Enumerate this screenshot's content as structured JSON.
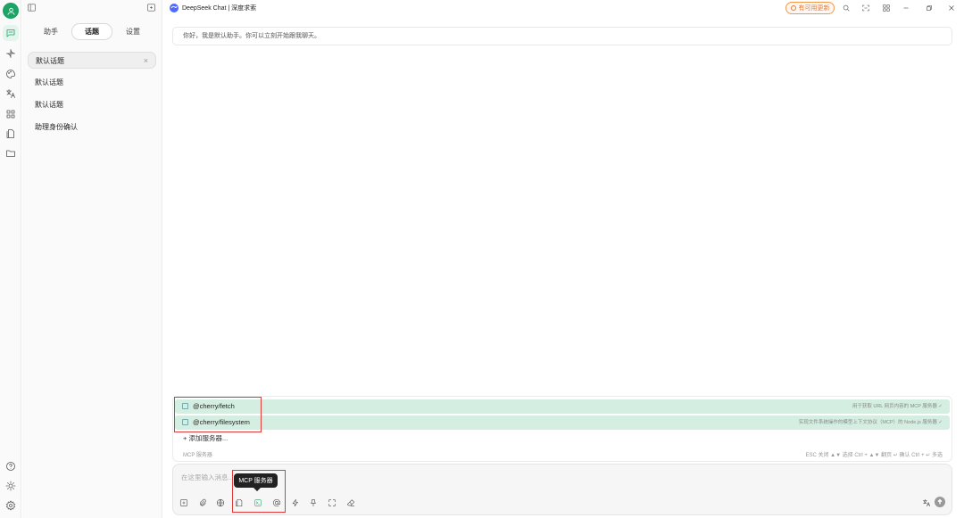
{
  "app": {
    "model_name": "DeepSeek Chat | 深度求索",
    "update_label": "有可用更新"
  },
  "colors": {
    "accent": "#1ba466",
    "update": "#e8793a",
    "highlight_row": "#d4efe2",
    "annotation_box": "#e03a3a"
  },
  "rail": {
    "icons": [
      "user-avatar",
      "chat-icon",
      "sparkle-icon",
      "palette-icon",
      "translate-icon",
      "apps-icon",
      "files-icon",
      "folder-icon"
    ],
    "bottom_icons": [
      "help-icon",
      "theme-icon",
      "settings-icon"
    ]
  },
  "panel": {
    "tabs": [
      {
        "label": "助手"
      },
      {
        "label": "话题",
        "active": true
      },
      {
        "label": "设置"
      }
    ],
    "topics": [
      {
        "label": "默认话题",
        "active": true
      },
      {
        "label": "默认话题"
      },
      {
        "label": "默认话题"
      },
      {
        "label": "助理身份确认"
      }
    ],
    "close_glyph": "×"
  },
  "main": {
    "greeting": "你好，我是默认助手。你可以立刻开始跟我聊天。"
  },
  "mcp": {
    "servers": [
      {
        "name": "@cherry/fetch",
        "desc": "用于获取 URL 网页内容的 MCP 服务器 ✓"
      },
      {
        "name": "@cherry/filesystem",
        "desc": "实现文件系统操作的模型上下文协议（MCP）的 Node.js 服务器 ✓"
      }
    ],
    "add_label": "+ 添加服务器...",
    "footer_left": "MCP 服务器",
    "footer_right": "ESC 关闭   ▲▼ 选择   Ctrl + ▲▼ 翻页   ↵ 确认   Ctrl + ↵ 多选"
  },
  "input": {
    "placeholder": "在这里输入消息...",
    "tooltip": "MCP 服务器"
  }
}
